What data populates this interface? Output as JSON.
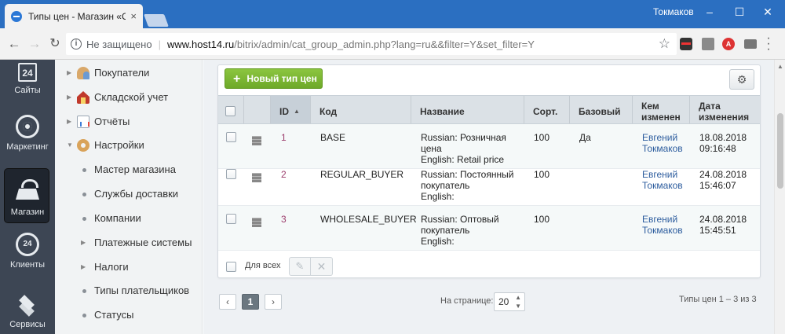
{
  "browser": {
    "tab_title": "Типы цен - Магазин «О",
    "user": "Токмаков",
    "insecure_label": "Не защищено",
    "url_host": "www.host14.ru",
    "url_path": "/bitrix/admin/cat_group_admin.php?lang=ru&&filter=Y&set_filter=Y"
  },
  "rail": {
    "items": [
      {
        "label": "Сайты",
        "icon": "sites-24-icon",
        "badge": "24"
      },
      {
        "label": "Маркетинг",
        "icon": "target-icon"
      },
      {
        "label": "Магазин",
        "icon": "basket-icon",
        "active": true
      },
      {
        "label": "Клиенты",
        "icon": "clients-24-icon",
        "badge": "24"
      },
      {
        "label": "Сервисы",
        "icon": "layers-icon"
      }
    ]
  },
  "tree": {
    "items": [
      {
        "label": "Покупатели",
        "icon": "buyers-icon",
        "expandable": true
      },
      {
        "label": "Складской учет",
        "icon": "store-icon",
        "expandable": true
      },
      {
        "label": "Отчёты",
        "icon": "reports-icon",
        "expandable": true
      },
      {
        "label": "Настройки",
        "icon": "settings-icon",
        "expandable": true,
        "expanded": true
      },
      {
        "label": "Мастер магазина"
      },
      {
        "label": "Службы доставки"
      },
      {
        "label": "Компании"
      },
      {
        "label": "Платежные системы",
        "expandable": true
      },
      {
        "label": "Налоги",
        "expandable": true
      },
      {
        "label": "Типы плательщиков"
      },
      {
        "label": "Статусы"
      }
    ]
  },
  "toolbar": {
    "add_label": "Новый тип цен"
  },
  "grid": {
    "columns": [
      "ID",
      "Код",
      "Название",
      "Сорт.",
      "Базовый",
      "Кем изменен",
      "Дата изменения"
    ],
    "rows": [
      {
        "id": "1",
        "code": "BASE",
        "name_ru": "Russian: Розничная цена",
        "name_en": "English: Retail price",
        "sort": "100",
        "base": "Да",
        "modified_by": "Евгений Токмаков",
        "date": "18.08.2018",
        "time": "09:16:48"
      },
      {
        "id": "2",
        "code": "REGULAR_BUYER",
        "name_ru": "Russian: Постоянный покупатель",
        "name_en": "English:",
        "sort": "100",
        "base": "",
        "modified_by": "Евгений Токмаков",
        "date": "24.08.2018",
        "time": "15:46:07"
      },
      {
        "id": "3",
        "code": "WHOLESALE_BUYER",
        "name_ru": "Russian: Оптовый покупатель",
        "name_en": "English:",
        "sort": "100",
        "base": "",
        "modified_by": "Евгений Токмаков",
        "date": "24.08.2018",
        "time": "15:45:51"
      }
    ],
    "for_all_label": "Для всех"
  },
  "pager": {
    "current": "1",
    "per_page_label": "На странице:",
    "per_page_value": "20",
    "total": "Типы цен 1 – 3 из 3"
  },
  "colors": {
    "rail_bg": "#3d4654",
    "accent_green": "#7ab536",
    "link": "#2d5d9e",
    "chrome_blue": "#2b6fc1"
  }
}
